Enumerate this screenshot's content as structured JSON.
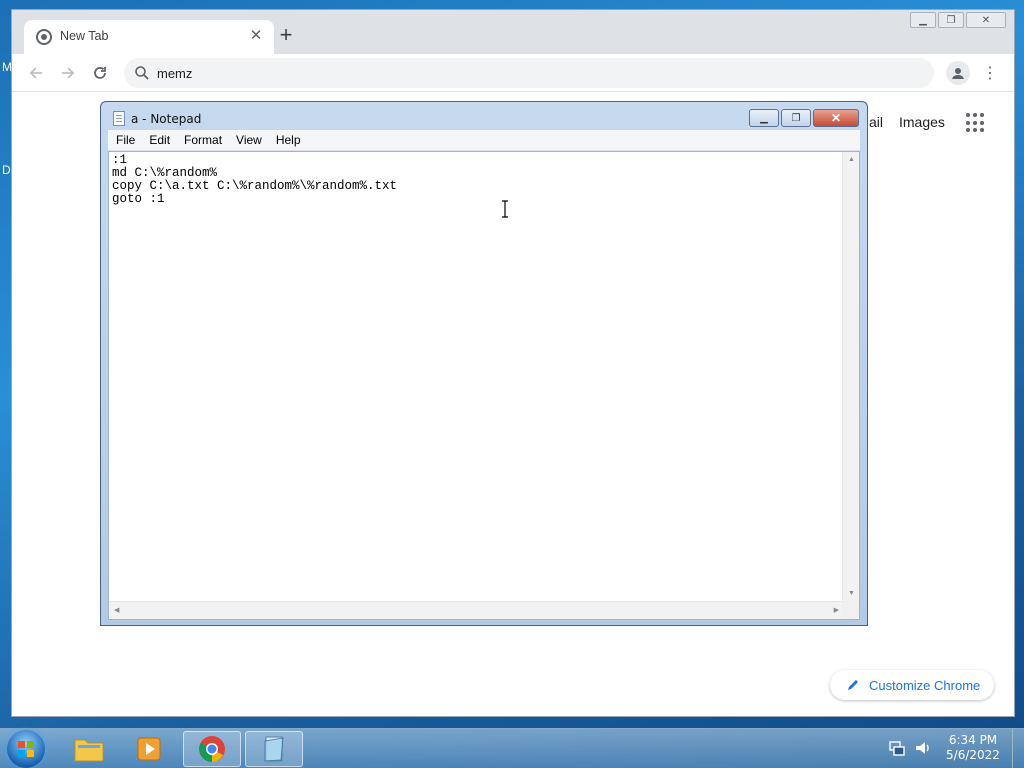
{
  "desktop": {
    "edge_chars": [
      "M",
      "D"
    ]
  },
  "chrome": {
    "tab": {
      "title": "New Tab"
    },
    "new_tab_symbol": "+",
    "omnibox": {
      "text": "memz"
    },
    "ntp_links": {
      "gmail": "ail",
      "images": "Images"
    },
    "customize_label": "Customize Chrome"
  },
  "notepad": {
    "title": "a - Notepad",
    "menu": [
      "File",
      "Edit",
      "Format",
      "View",
      "Help"
    ],
    "content": ":1\nmd C:\\%random%\ncopy C:\\a.txt C:\\%random%\\%random%.txt\ngoto :1"
  },
  "taskbar": {
    "time": "6:34 PM",
    "date": "5/6/2022",
    "items": [
      "explorer",
      "media-player",
      "chrome",
      "notepad"
    ]
  },
  "colors": {
    "accent": "#1a73e8",
    "notepad_close": "#c74a33"
  }
}
